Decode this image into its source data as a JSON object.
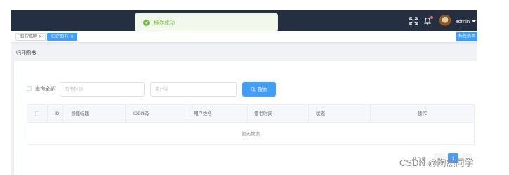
{
  "toast": {
    "text": "操作成功",
    "icon": "check-circle-icon",
    "color": "#67c23a"
  },
  "header": {
    "username": "admin",
    "icons": [
      "fullscreen-icon",
      "bell-icon"
    ],
    "background": "#242f42"
  },
  "tags": [
    {
      "label": "图书管理",
      "active": false
    },
    {
      "label": "归还图书",
      "active": true
    }
  ],
  "tag_options_label": "标签选项",
  "page_title": "归还图书",
  "filters": {
    "query_all_label": "查询全部",
    "book_title_placeholder": "图书标题",
    "username_placeholder": "用户名",
    "search_label": "搜索"
  },
  "table": {
    "columns": [
      "ID",
      "书籍标题",
      "ISBN码",
      "用户姓名",
      "借书时间",
      "状态",
      "操作"
    ],
    "empty_text": "暂无数据"
  },
  "pagination": {
    "total_text": "共 0 条",
    "current_page": "1",
    "prev": "‹",
    "next": "›"
  },
  "watermark": "CSDN @陶然同学",
  "accent_color": "#409eff"
}
